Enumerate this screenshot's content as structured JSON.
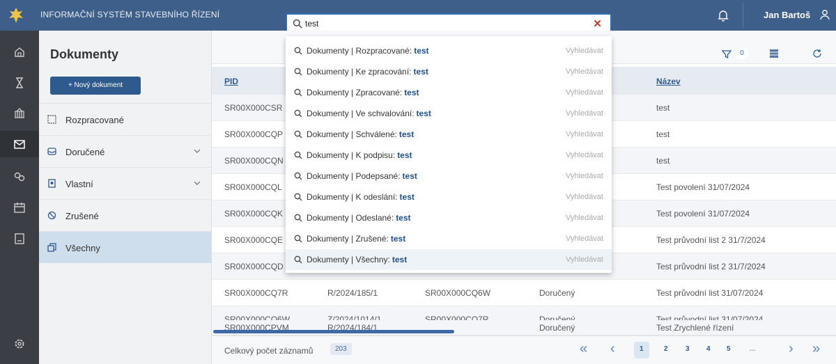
{
  "header": {
    "app_title": "INFORMAČNÍ SYSTÉM STAVEBNÍHO ŘÍZENÍ",
    "user_name": "Jan Bartoš"
  },
  "search": {
    "value": "test",
    "clear_symbol": "✕",
    "results": [
      {
        "prefix": "Dokumenty | Rozpracované:",
        "query": "test",
        "action": "Vyhledávat"
      },
      {
        "prefix": "Dokumenty | Ke zpracování:",
        "query": "test",
        "action": "Vyhledávat"
      },
      {
        "prefix": "Dokumenty | Zpracované:",
        "query": "test",
        "action": "Vyhledávat"
      },
      {
        "prefix": "Dokumenty | Ve schvalování:",
        "query": "test",
        "action": "Vyhledávat"
      },
      {
        "prefix": "Dokumenty | Schválené:",
        "query": "test",
        "action": "Vyhledávat"
      },
      {
        "prefix": "Dokumenty | K podpisu:",
        "query": "test",
        "action": "Vyhledávat"
      },
      {
        "prefix": "Dokumenty | Podepsané:",
        "query": "test",
        "action": "Vyhledávat"
      },
      {
        "prefix": "Dokumenty | K odeslání:",
        "query": "test",
        "action": "Vyhledávat"
      },
      {
        "prefix": "Dokumenty | Odeslané:",
        "query": "test",
        "action": "Vyhledávat"
      },
      {
        "prefix": "Dokumenty | Zrušené:",
        "query": "test",
        "action": "Vyhledávat"
      },
      {
        "prefix": "Dokumenty | Všechny:",
        "query": "test",
        "action": "Vyhledávat"
      }
    ]
  },
  "sidebar": {
    "title": "Dokumenty",
    "new_button": "+ Nový dokument",
    "items": [
      {
        "label": "Rozpracované"
      },
      {
        "label": "Doručené"
      },
      {
        "label": "Vlastní"
      },
      {
        "label": "Zrušené"
      },
      {
        "label": "Všechny"
      }
    ]
  },
  "toolbar": {
    "filter_count": "0"
  },
  "table": {
    "headers": {
      "pid": "PID",
      "nazev": "Název"
    },
    "rows": [
      {
        "pid": "SR00X000CSR",
        "c2": "",
        "c3": "",
        "stav": "",
        "nazev": "test"
      },
      {
        "pid": "SR00X000CQP",
        "c2": "",
        "c3": "",
        "stav": "",
        "nazev": "test"
      },
      {
        "pid": "SR00X000CQN",
        "c2": "",
        "c3": "",
        "stav": "",
        "nazev": "test"
      },
      {
        "pid": "SR00X000CQL",
        "c2": "",
        "c3": "",
        "stav": "",
        "nazev": "Test povolení 31/07/2024"
      },
      {
        "pid": "SR00X000CQK",
        "c2": "",
        "c3": "",
        "stav": "",
        "nazev": "Test povolení 31/07/2024"
      },
      {
        "pid": "SR00X000CQE",
        "c2": "",
        "c3": "",
        "stav": "",
        "nazev": "Test průvodní list 2 31/7/2024"
      },
      {
        "pid": "SR00X000CQD",
        "c2": "",
        "c3": "",
        "stav": "",
        "nazev": "Test průvodní list 2 31/7/2024"
      },
      {
        "pid": "SR00X000CQ7R",
        "c2": "R/2024/185/1",
        "c3": "SR00X000CQ6W",
        "stav": "Doručený",
        "nazev": "Test průvodní list 31/07/2024"
      },
      {
        "pid": "SR00X000CQ6W",
        "c2": "Z/2024/1014/1",
        "c3": "SR00X000CQ7R",
        "stav": "Doručený",
        "nazev": "Test průvodní list 31/07/2024"
      },
      {
        "pid": "SR00X000CPVM",
        "c2": "R/2024/184/1",
        "c3": "",
        "stav": "Doručený",
        "nazev": "Test Zrychlené řízení"
      }
    ]
  },
  "footer": {
    "total_label": "Celkový počet záznamů",
    "total_value": "203",
    "pages": [
      "1",
      "2",
      "3",
      "4",
      "5",
      "..."
    ],
    "active_page": "1"
  },
  "colors": {
    "header_bg": "#3e5f8a",
    "rail_bg": "#3b3f45",
    "accent": "#2f5a8e",
    "active_nav": "#cfdeec"
  }
}
